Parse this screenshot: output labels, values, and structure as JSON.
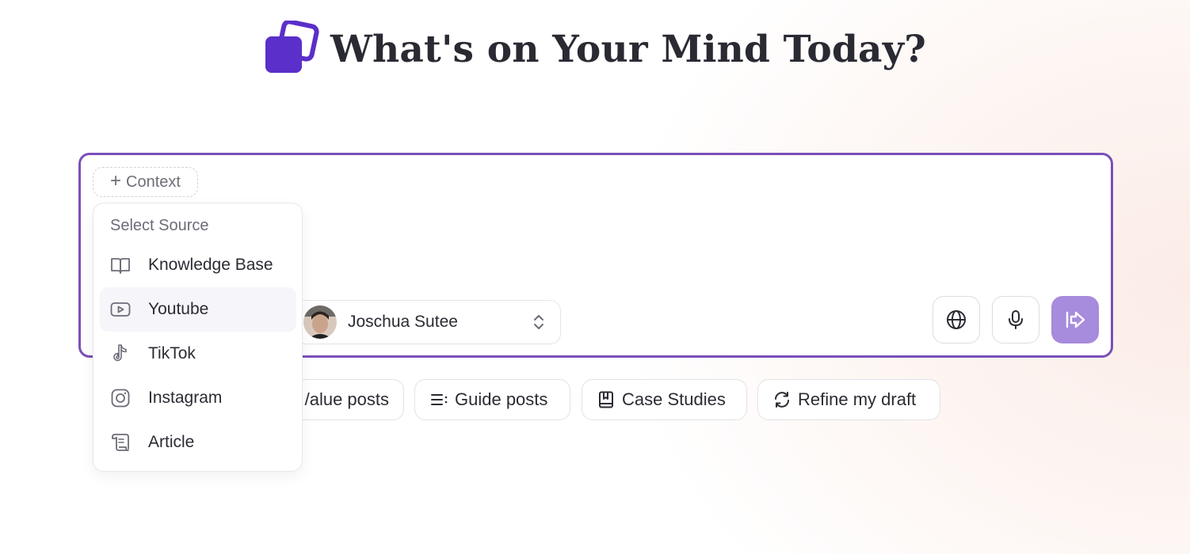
{
  "header": {
    "title": "What's on Your Mind Today?",
    "logo_icon": "stacked-squares-logo",
    "logo_color": "#5b2fc9"
  },
  "composer": {
    "border_color": "#7a4fb8",
    "context_label": "Context",
    "persona": {
      "name": "Joschua Sutee",
      "avatar_icon": "user-avatar"
    },
    "actions": {
      "globe_icon": "globe-icon",
      "mic_icon": "microphone-icon",
      "send_icon": "send-arrow-icon",
      "send_color": "#a78bdc"
    }
  },
  "source_menu": {
    "title": "Select Source",
    "items": [
      {
        "label": "Knowledge Base",
        "icon": "book-open-icon",
        "active": false
      },
      {
        "label": "Youtube",
        "icon": "youtube-icon",
        "active": true
      },
      {
        "label": "TikTok",
        "icon": "tiktok-icon",
        "active": false
      },
      {
        "label": "Instagram",
        "icon": "instagram-icon",
        "active": false
      },
      {
        "label": "Article",
        "icon": "scroll-icon",
        "active": false
      }
    ]
  },
  "chips": [
    {
      "label": "Value posts",
      "visible_text": "/alue posts"
    },
    {
      "label": "Guide posts",
      "icon": "list-icon"
    },
    {
      "label": "Case Studies",
      "icon": "bookmark-book-icon"
    },
    {
      "label": "Refine my draft",
      "icon": "refresh-icon"
    }
  ]
}
